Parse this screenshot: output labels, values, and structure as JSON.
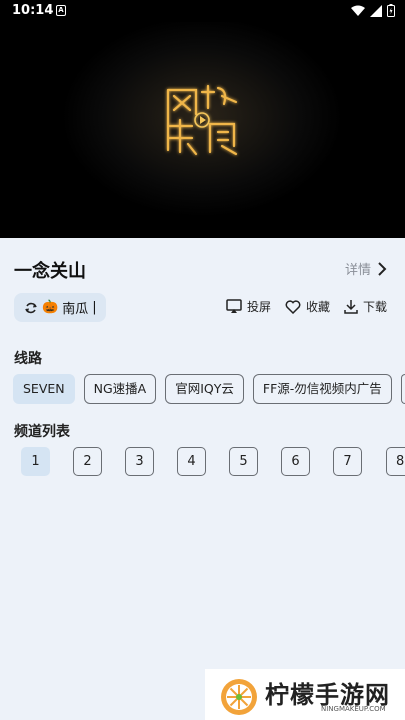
{
  "status": {
    "time": "10:14",
    "notif_icon": "A"
  },
  "video": {
    "logo_chars": [
      "网",
      "络",
      "视",
      "听"
    ]
  },
  "title": "一念关山",
  "detail_label": "详情",
  "source": {
    "emoji": "🎃",
    "name": "南瓜",
    "cursor": "|"
  },
  "actions": {
    "cast": "投屏",
    "favorite": "收藏",
    "download": "下载"
  },
  "lines_label": "线路",
  "lines": [
    "SEVEN",
    "NG速播A",
    "官网IQY云",
    "FF源-勿信视频内广告"
  ],
  "episodes_label": "频道列表",
  "episodes": [
    "1",
    "2",
    "3",
    "4",
    "5",
    "6",
    "7",
    "8"
  ],
  "watermark": {
    "text": "柠檬手游网",
    "url": "NINGMAKEUP.COM"
  },
  "colors": {
    "bg": "#edf2f9",
    "chip_active": "#d5e4f3",
    "accent_gold": "#e8a636"
  }
}
